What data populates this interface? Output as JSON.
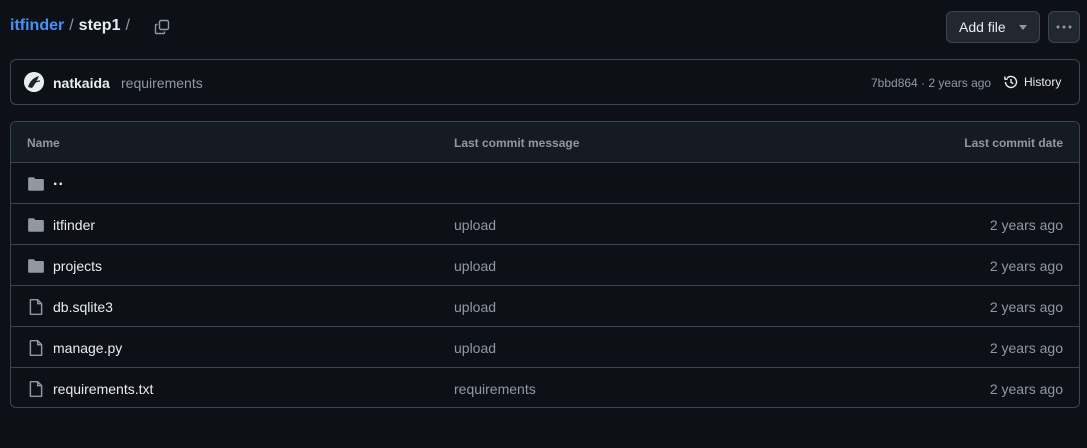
{
  "breadcrumb": {
    "repo": "itfinder",
    "sep1": "/",
    "dir": "step1",
    "sep2": "/"
  },
  "toolbar": {
    "add_file_label": "Add file"
  },
  "commit": {
    "author": "natkaida",
    "message": "requirements",
    "hash": "7bbd864",
    "dot": " · ",
    "age": "2 years ago",
    "history_label": "History"
  },
  "table": {
    "headers": {
      "name": "Name",
      "message": "Last commit message",
      "date": "Last commit date"
    },
    "parent_label": "..",
    "rows": [
      {
        "type": "folder",
        "name": "itfinder",
        "message": "upload",
        "date": "2 years ago"
      },
      {
        "type": "folder",
        "name": "projects",
        "message": "upload",
        "date": "2 years ago"
      },
      {
        "type": "file",
        "name": "db.sqlite3",
        "message": "upload",
        "date": "2 years ago"
      },
      {
        "type": "file",
        "name": "manage.py",
        "message": "upload",
        "date": "2 years ago"
      },
      {
        "type": "file",
        "name": "requirements.txt",
        "message": "requirements",
        "date": "2 years ago"
      }
    ]
  },
  "colors": {
    "background": "#0d1117",
    "border": "#3d444d",
    "link": "#4493f8",
    "muted": "#9198a1",
    "text": "#e6edf3"
  },
  "icons": {
    "copy": "copy-icon",
    "caret": "triangle-down-icon",
    "more": "kebab-horizontal-icon",
    "history": "history-icon",
    "folder": "folder-icon",
    "file": "file-icon"
  }
}
